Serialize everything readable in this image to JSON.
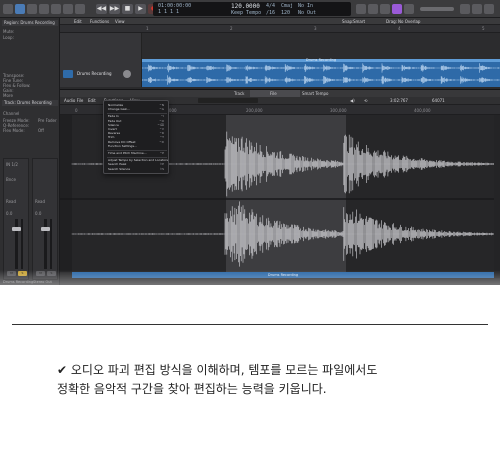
{
  "control_bar": {
    "position_bars": "01:00:00:00",
    "position_beats": "1  1  1    1",
    "tempo": "120.0000",
    "time_signature": "4/4",
    "key": "Cmaj",
    "tempo_label": "Keep Tempo",
    "division": "/16",
    "count_label": "No In",
    "count_out": "No Out",
    "bpm_small": "120"
  },
  "inspector": {
    "region_label": "Region: Drums Recording",
    "rows": [
      "Mute:",
      "Loop:",
      "Transpose:",
      "Fine Tune:",
      "Flex & Follow:",
      "Gain:",
      "More"
    ],
    "track_label": "Track: Drums Recording",
    "track_rows": [
      "Channel",
      "Freeze Mode:",
      "Q-Reference:",
      "Flex Mode:"
    ],
    "channel_values": [
      "Pre Fader",
      "Off"
    ],
    "strip_left_name": "Drums Recording",
    "strip_right_name": "Stereo Out",
    "strip_left_input": "IN 1/2",
    "strip_left_bnce": "Bnce",
    "strip_right_read": "Read",
    "strip_left_read": "Read",
    "strip_left_val": "0.0",
    "strip_right_val": "0.0",
    "strip_left_m": "M",
    "strip_left_s": "S",
    "strip_right_m": "M",
    "strip_right_s": "S"
  },
  "tracks_menu": [
    "Edit",
    "Functions",
    "View"
  ],
  "tracks_right": [
    "Snap:",
    "Smart",
    "Drag:",
    "No Overlap"
  ],
  "track_ruler": [
    "1",
    "2",
    "3",
    "4",
    "5"
  ],
  "track": {
    "name": "Drums Recording",
    "region_name": "Drums Recording"
  },
  "editor": {
    "tabs": [
      "Track",
      "File",
      "Smart Tempo"
    ],
    "active_tab": 1,
    "menu": [
      "Audio File",
      "Edit",
      "Functions",
      "View"
    ],
    "time_display": "3:02:767",
    "sample_value": "64071",
    "ruler": [
      "0",
      "100,000",
      "200,000",
      "300,000",
      "400,000"
    ],
    "bottom_region": "Drums Recording"
  },
  "dropdown": {
    "items": [
      {
        "label": "Normalize",
        "shortcut": "^N"
      },
      {
        "label": "Change Gain...",
        "shortcut": "^G"
      },
      {
        "label": "Fade In",
        "shortcut": "^I"
      },
      {
        "label": "Fade Out",
        "shortcut": "^O"
      },
      {
        "label": "Silence",
        "shortcut": "^⌫"
      },
      {
        "label": "Invert",
        "shortcut": "^V"
      },
      {
        "label": "Reverse",
        "shortcut": "^R"
      },
      {
        "label": "Trim",
        "shortcut": "^T"
      },
      {
        "label": "Remove DC Offset",
        "shortcut": "^D"
      },
      {
        "label": "Function Settings...",
        "shortcut": ""
      },
      {
        "label": "Time and Pitch Machine...",
        "shortcut": "^P"
      },
      {
        "label": "Adjust Tempo by Selection and Locators",
        "shortcut": ""
      },
      {
        "label": "Search Peak",
        "shortcut": "⇧P"
      },
      {
        "label": "Search Silence",
        "shortcut": "⇧S"
      }
    ]
  },
  "caption": {
    "line1": "✔ 오디오 파괴 편집 방식을 이해하며, 템포를 모르는 파일에서도",
    "line2": "정확한 음악적 구간을 찾아 편집하는 능력을 키웁니다."
  },
  "colors": {
    "region_blue": "#2e6aa8",
    "region_top": "#5f9dd8",
    "background_dark": "#2a2a2c",
    "waveform": "#d8d8dc",
    "record_red": "#d8342c"
  }
}
